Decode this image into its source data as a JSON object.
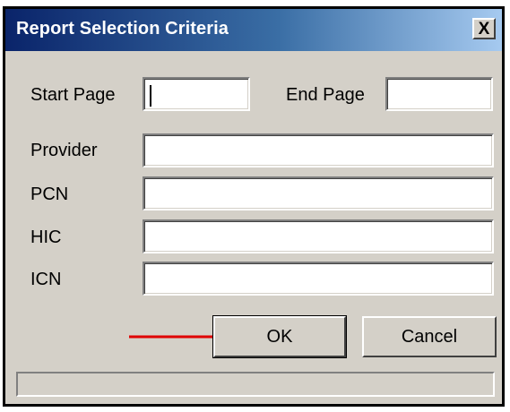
{
  "window": {
    "title": "Report Selection Criteria",
    "close_label": "X"
  },
  "form": {
    "start_page_label": "Start Page",
    "start_page_value": "",
    "end_page_label": "End Page",
    "end_page_value": "",
    "provider_label": "Provider",
    "provider_value": "",
    "pcn_label": "PCN",
    "pcn_value": "",
    "hic_label": "HIC",
    "hic_value": "",
    "icn_label": "ICN",
    "icn_value": ""
  },
  "buttons": {
    "ok_label": "OK",
    "cancel_label": "Cancel"
  },
  "annotation": {
    "arrow_color": "#e00000"
  },
  "status_bar": {
    "text": ""
  },
  "colors": {
    "dialog_bg": "#d4d0c8",
    "titlebar_start": "#0a246a",
    "titlebar_end": "#a6caf0"
  }
}
